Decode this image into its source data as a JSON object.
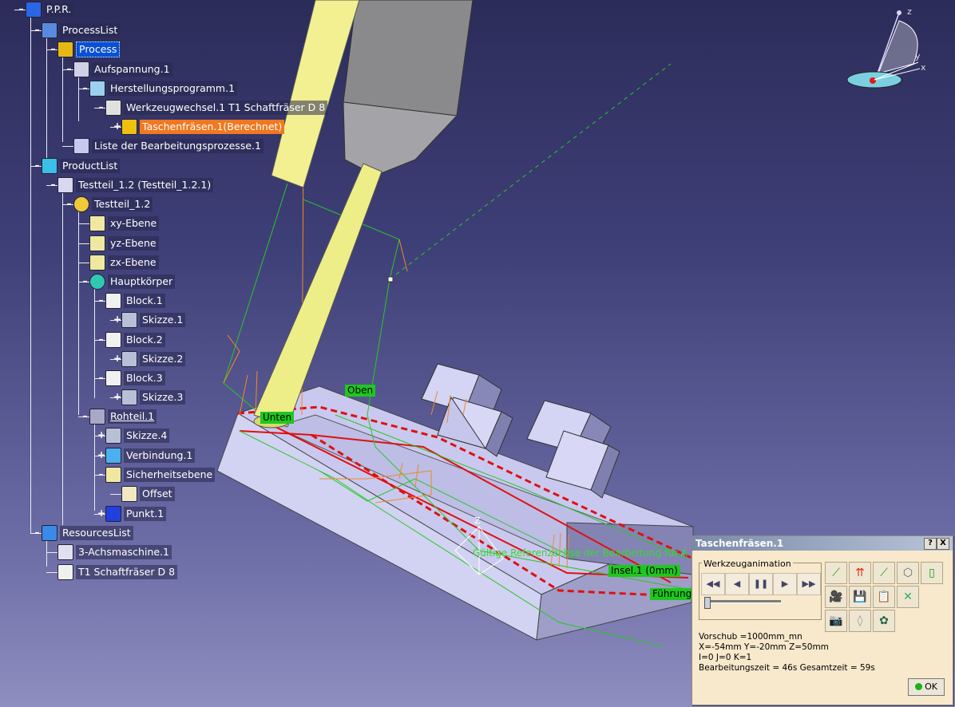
{
  "tree": {
    "nodes": [
      {
        "label": "P.P.R.",
        "icon": "ppr-icon"
      },
      {
        "label": "ProcessList",
        "icon": "process-list-icon"
      },
      {
        "label": "Process",
        "icon": "process-icon"
      },
      {
        "label": "Aufspannung.1",
        "icon": "setup-icon"
      },
      {
        "label": "Herstellungsprogramm.1",
        "icon": "program-icon"
      },
      {
        "label": "Werkzeugwechsel.1  T1 Schaftfräser D 8",
        "icon": "tool-change-icon"
      },
      {
        "label": "Taschenfräsen.1(Berechnet)",
        "icon": "pocketing-icon"
      },
      {
        "label": "Liste der Bearbeitungsprozesse.1",
        "icon": "process-list-icon"
      },
      {
        "label": "ProductList",
        "icon": "product-list-icon"
      },
      {
        "label": "Testteil_1.2 (Testteil_1.2.1)",
        "icon": "product-icon"
      },
      {
        "label": "Testteil_1.2",
        "icon": "part-icon"
      },
      {
        "label": "xy-Ebene",
        "icon": "plane-icon"
      },
      {
        "label": "yz-Ebene",
        "icon": "plane-icon"
      },
      {
        "label": "zx-Ebene",
        "icon": "plane-icon"
      },
      {
        "label": "Hauptkörper",
        "icon": "body-icon"
      },
      {
        "label": "Block.1",
        "icon": "pad-icon"
      },
      {
        "label": "Skizze.1",
        "icon": "sketch-icon"
      },
      {
        "label": "Block.2",
        "icon": "pad-icon"
      },
      {
        "label": "Skizze.2",
        "icon": "sketch-icon"
      },
      {
        "label": "Block.3",
        "icon": "pad-icon"
      },
      {
        "label": "Skizze.3",
        "icon": "sketch-icon"
      },
      {
        "label": "Rohteil.1",
        "icon": "stock-icon"
      },
      {
        "label": "Skizze.4",
        "icon": "sketch-icon"
      },
      {
        "label": "Verbindung.1",
        "icon": "join-icon"
      },
      {
        "label": "Sicherheitsebene",
        "icon": "plane-icon"
      },
      {
        "label": "Offset",
        "icon": "offset-icon"
      },
      {
        "label": "Punkt.1",
        "icon": "point-icon"
      },
      {
        "label": "ResourcesList",
        "icon": "resources-icon"
      },
      {
        "label": "3-Achsmaschine.1",
        "icon": "machine-icon"
      },
      {
        "label": "T1 Schaftfräser D 8",
        "icon": "end-mill-icon"
      }
    ]
  },
  "scene": {
    "tag_oben": "Oben",
    "tag_unten": "Unten",
    "tag_insel": "Insel.1 (0mm)",
    "tag_fuehrung": "Führung",
    "annotation": "Gültige Referenzachse der Bearbeitung für A",
    "axis_z": "z",
    "axis_y": "y",
    "axis_x": "x",
    "axis_z_small": "Z"
  },
  "dialog": {
    "title": "Taschenfräsen.1",
    "help_label": "?",
    "close_label": "X",
    "group_label": "Werkzeuganimation",
    "playback": [
      "◀◀",
      "◀",
      "❚❚",
      "▶",
      "▶▶"
    ],
    "info": {
      "feed": "Vorschub =1000mm_mn",
      "position": "X=-54mm Y=-20mm Z=50mm",
      "ijk": "I=0 J=0 K=1",
      "time": "Bearbeitungszeit = 46s    Gesamtzeit = 59s"
    },
    "ok_label": "OK"
  }
}
